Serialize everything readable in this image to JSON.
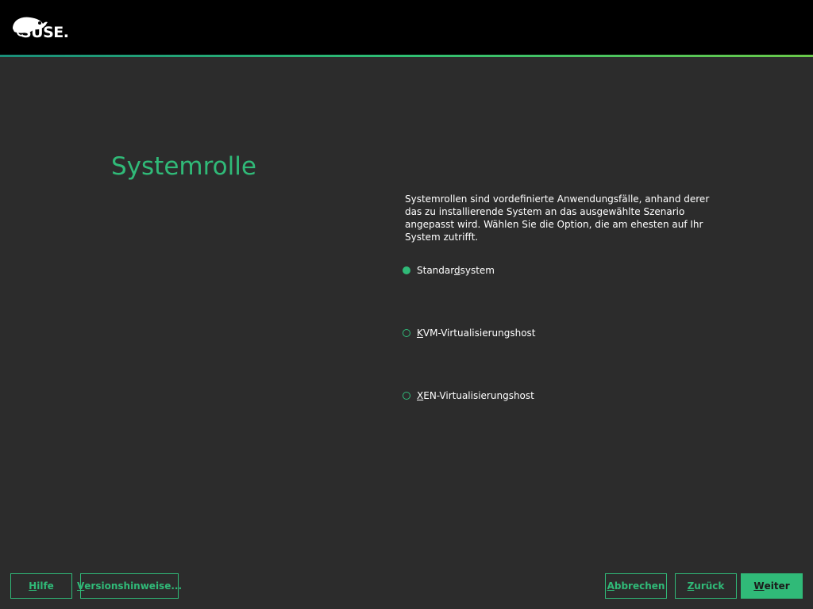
{
  "header": {
    "brand": "SUSE.",
    "logo_icon": "suse-chameleon-icon"
  },
  "page": {
    "title": "Systemrolle",
    "description": "Systemrollen sind vordefinierte Anwendungsfälle, anhand derer das zu installierende System an das ausgewählte Szenario angepasst wird. Wählen Sie die Option, die am ehesten auf Ihr System zutrifft."
  },
  "roles": {
    "selected": "Standardsystem",
    "options": [
      {
        "pre": "Standar",
        "key": "d",
        "post": "system",
        "checked": true
      },
      {
        "pre": "",
        "key": "K",
        "post": "VM-Virtualisierungshost",
        "checked": false
      },
      {
        "pre": "",
        "key": "X",
        "post": "EN-Virtualisierungshost",
        "checked": false
      }
    ]
  },
  "buttons": {
    "help": {
      "key": "H",
      "rest": "ilfe"
    },
    "release_notes": {
      "key": "V",
      "rest": "ersionshinweise..."
    },
    "abort": {
      "key": "A",
      "rest": "bbrechen"
    },
    "back": {
      "key": "Z",
      "rest": "urück"
    },
    "next": {
      "key": "W",
      "rest": "eiter"
    }
  },
  "colors": {
    "accent": "#30ba78",
    "background": "#2c2c2c",
    "header": "#000000"
  }
}
